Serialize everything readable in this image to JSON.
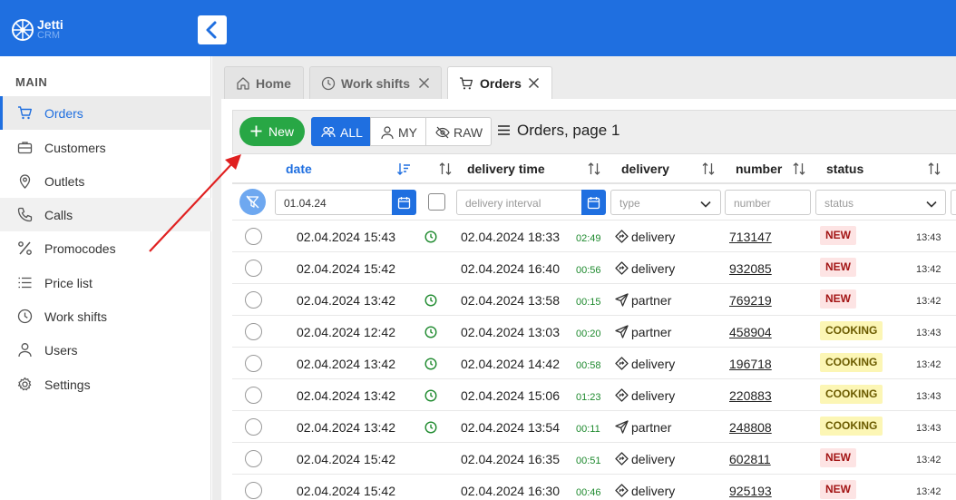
{
  "brand": {
    "name": "Jetti",
    "sub": "CRM"
  },
  "sidebar": {
    "section": "MAIN",
    "items": [
      {
        "label": "Orders",
        "icon": "cart-icon"
      },
      {
        "label": "Customers",
        "icon": "briefcase-icon"
      },
      {
        "label": "Outlets",
        "icon": "location-pin-icon"
      },
      {
        "label": "Calls",
        "icon": "phone-icon"
      },
      {
        "label": "Promocodes",
        "icon": "percent-icon"
      },
      {
        "label": "Price list",
        "icon": "list-icon"
      },
      {
        "label": "Work shifts",
        "icon": "clock-icon"
      },
      {
        "label": "Users",
        "icon": "user-icon"
      },
      {
        "label": "Settings",
        "icon": "gear-icon"
      }
    ]
  },
  "tabs": [
    {
      "label": "Home",
      "icon": "home-icon"
    },
    {
      "label": "Work shifts",
      "icon": "clock-icon"
    },
    {
      "label": "Orders",
      "icon": "cart-icon"
    }
  ],
  "toolbar": {
    "new_label": "New",
    "filters": [
      {
        "label": "ALL",
        "icon": "users-icon"
      },
      {
        "label": "MY",
        "icon": "user-icon"
      },
      {
        "label": "RAW",
        "icon": "eye-off-icon"
      }
    ],
    "page_title": "Orders, page 1"
  },
  "columns": {
    "date": "date",
    "delivery_time": "delivery time",
    "delivery": "delivery",
    "number": "number",
    "status": "status"
  },
  "filters": {
    "date_value": "01.04.24",
    "delivery_interval_placeholder": "delivery interval",
    "type_placeholder": "type",
    "number_placeholder": "number",
    "status_placeholder": "status"
  },
  "rows": [
    {
      "date": "02.04.2024 15:43",
      "clock": true,
      "delivery_time": "02.04.2024 18:33",
      "elapsed": "02:49",
      "type": "delivery",
      "number": "713147",
      "status": "NEW",
      "time": "13:43"
    },
    {
      "date": "02.04.2024 15:42",
      "clock": false,
      "delivery_time": "02.04.2024 16:40",
      "elapsed": "00:56",
      "type": "delivery",
      "number": "932085",
      "status": "NEW",
      "time": "13:42"
    },
    {
      "date": "02.04.2024 13:42",
      "clock": true,
      "delivery_time": "02.04.2024 13:58",
      "elapsed": "00:15",
      "type": "partner",
      "number": "769219",
      "status": "NEW",
      "time": "13:42"
    },
    {
      "date": "02.04.2024 12:42",
      "clock": true,
      "delivery_time": "02.04.2024 13:03",
      "elapsed": "00:20",
      "type": "partner",
      "number": "458904",
      "status": "COOKING",
      "time": "13:43"
    },
    {
      "date": "02.04.2024 13:42",
      "clock": true,
      "delivery_time": "02.04.2024 14:42",
      "elapsed": "00:58",
      "type": "delivery",
      "number": "196718",
      "status": "COOKING",
      "time": "13:42"
    },
    {
      "date": "02.04.2024 13:42",
      "clock": true,
      "delivery_time": "02.04.2024 15:06",
      "elapsed": "01:23",
      "type": "delivery",
      "number": "220883",
      "status": "COOKING",
      "time": "13:43"
    },
    {
      "date": "02.04.2024 13:42",
      "clock": true,
      "delivery_time": "02.04.2024 13:54",
      "elapsed": "00:11",
      "type": "partner",
      "number": "248808",
      "status": "COOKING",
      "time": "13:43"
    },
    {
      "date": "02.04.2024 15:42",
      "clock": false,
      "delivery_time": "02.04.2024 16:35",
      "elapsed": "00:51",
      "type": "delivery",
      "number": "602811",
      "status": "NEW",
      "time": "13:42"
    },
    {
      "date": "02.04.2024 15:42",
      "clock": false,
      "delivery_time": "02.04.2024 16:30",
      "elapsed": "00:46",
      "type": "delivery",
      "number": "925193",
      "status": "NEW",
      "time": "13:42"
    }
  ],
  "colors": {
    "primary": "#1f6fe0",
    "success": "#28a745",
    "annotation_arrow": "#e02020"
  }
}
